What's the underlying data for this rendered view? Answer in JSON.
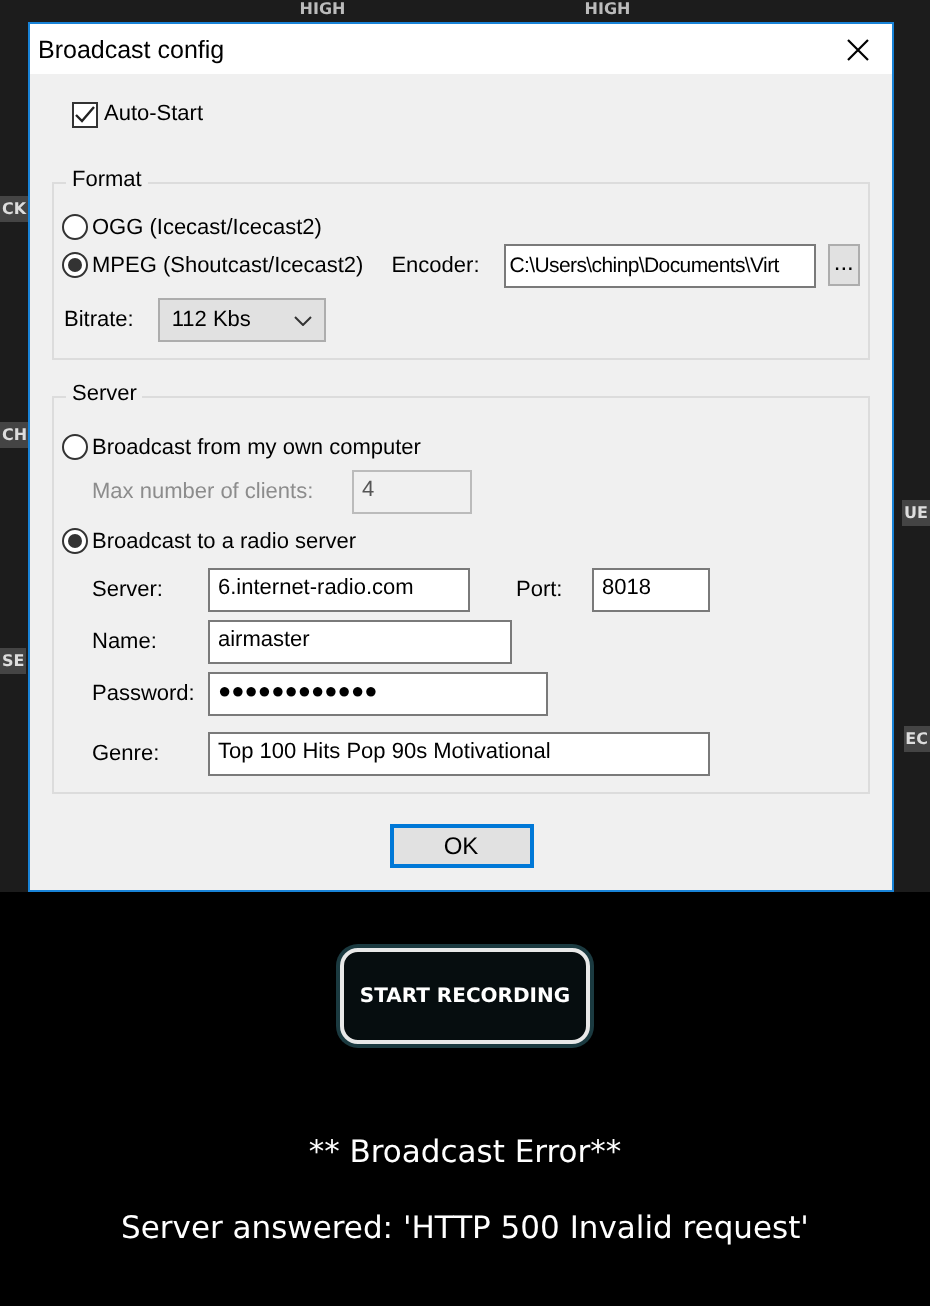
{
  "backdrop": {
    "left_labels": [
      "CK",
      "CH",
      "SE"
    ],
    "right_labels": [
      "UE",
      "EC"
    ],
    "top_labels": [
      "HIGH",
      "HIGH"
    ]
  },
  "dialog": {
    "title": "Broadcast config",
    "auto_start": {
      "label": "Auto-Start",
      "checked": true
    },
    "format": {
      "legend": "Format",
      "options": [
        {
          "label": "OGG (Icecast/Icecast2)",
          "selected": false
        },
        {
          "label": "MPEG (Shoutcast/Icecast2)",
          "selected": true
        }
      ],
      "encoder_label": "Encoder:",
      "encoder_value": "C:\\Users\\chinp\\Documents\\Virt",
      "browse": "...",
      "bitrate_label": "Bitrate:",
      "bitrate_value": "112 Kbs"
    },
    "server": {
      "legend": "Server",
      "modes": [
        {
          "label": "Broadcast from my own computer",
          "selected": false
        },
        {
          "label": "Broadcast to a radio server",
          "selected": true
        }
      ],
      "max_clients": {
        "label": "Max number of clients:",
        "value": "4",
        "disabled": true
      },
      "fields": [
        {
          "label": "Server:",
          "value": "6.internet-radio.com"
        },
        {
          "label": "Name:",
          "value": "airmaster"
        },
        {
          "label": "Password:",
          "value": "●●●●●●●●●●●●"
        },
        {
          "label": "Genre:",
          "value": "Top 100 Hits Pop 90s Motivational"
        }
      ],
      "port": {
        "label": "Port:",
        "value": "8018"
      }
    },
    "ok": "OK"
  },
  "record_button": "START RECORDING",
  "error_title": "** Broadcast Error**",
  "error_message": "Server answered: 'HTTP 500 Invalid request'"
}
